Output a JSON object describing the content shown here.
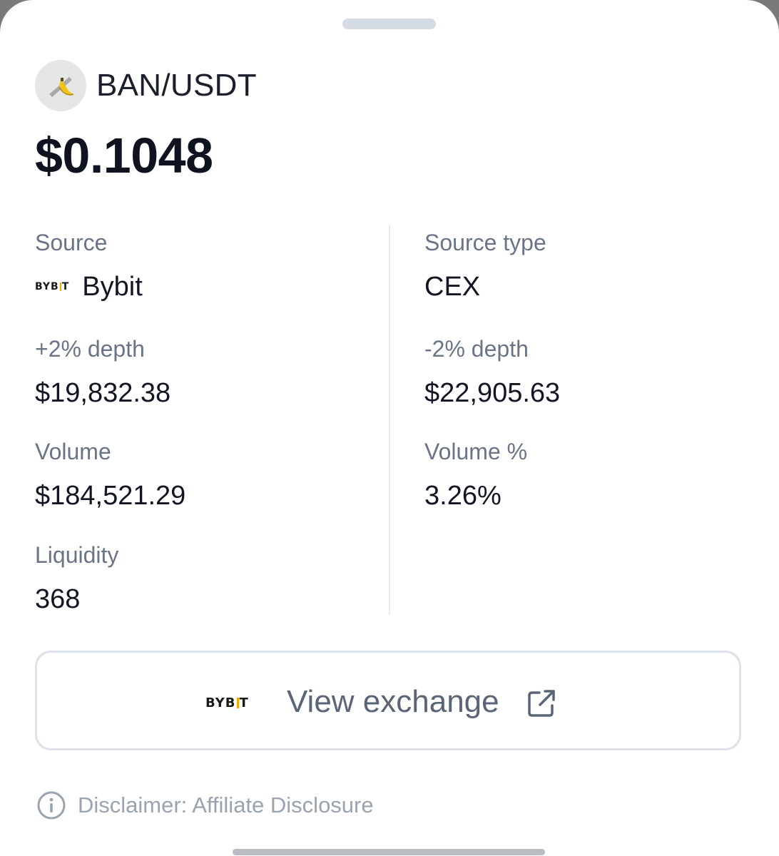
{
  "pair": {
    "name": "BAN/USDT",
    "price": "$0.1048",
    "logo_icon": "banana-taped-icon"
  },
  "details": {
    "source": {
      "label": "Source",
      "value": "Bybit",
      "logo_text": "BYB",
      "logo_text_end": "T"
    },
    "source_type": {
      "label": "Source type",
      "value": "CEX"
    },
    "plus_depth": {
      "label": "+2% depth",
      "value": "$19,832.38"
    },
    "minus_depth": {
      "label": "-2% depth",
      "value": "$22,905.63"
    },
    "volume": {
      "label": "Volume",
      "value": "$184,521.29"
    },
    "volume_pct": {
      "label": "Volume %",
      "value": "3.26%"
    },
    "liquidity": {
      "label": "Liquidity",
      "value": "368"
    }
  },
  "exchange_button": {
    "label": "View exchange",
    "logo_text": "BYB",
    "logo_text_end": "T",
    "icon": "external-link-icon"
  },
  "disclaimer": {
    "text": "Disclaimer: Affiliate Disclosure",
    "icon": "info-icon"
  },
  "colors": {
    "accent_bybit": "#f7a600",
    "label_gray": "#697586",
    "value_dark": "#111622"
  }
}
